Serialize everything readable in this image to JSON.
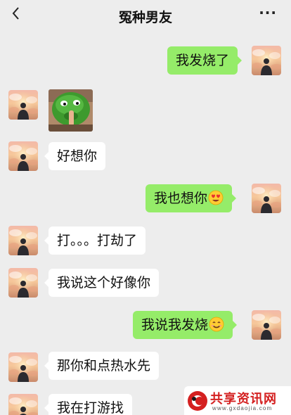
{
  "header": {
    "title": "冤种男友",
    "back_icon": "chevron-left-icon",
    "more_label": "···"
  },
  "colors": {
    "background": "#EDEDED",
    "outgoing_bubble": "#95EC69",
    "incoming_bubble": "#FFFFFF"
  },
  "messages": [
    {
      "side": "out",
      "type": "text",
      "text": "我发烧了"
    },
    {
      "side": "in",
      "type": "sticker",
      "sticker": "green-mask-sticker"
    },
    {
      "side": "in",
      "type": "text",
      "text": "好想你"
    },
    {
      "side": "out",
      "type": "text",
      "text": "我也想你",
      "emoji": "heart-eyes-emoji"
    },
    {
      "side": "in",
      "type": "text",
      "text": "打。。。打劫了"
    },
    {
      "side": "in",
      "type": "text",
      "text": "我说这个好像你"
    },
    {
      "side": "out",
      "type": "text",
      "text": "我说我发烧",
      "emoji": "smile-emoji"
    },
    {
      "side": "in",
      "type": "text",
      "text": "那你和点热水先"
    },
    {
      "side": "in",
      "type": "text",
      "text": "我在打游找"
    }
  ],
  "watermark": {
    "name": "共享资讯网",
    "url": "www.gxdaojia.com"
  }
}
